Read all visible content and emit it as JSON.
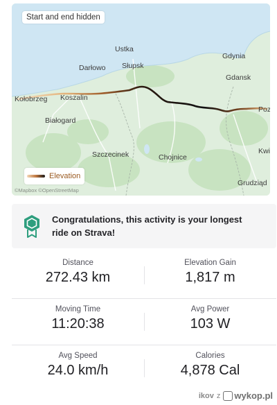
{
  "map": {
    "badge": "Start and end hidden",
    "legend_label": "Elevation",
    "attribution": "©Mapbox ©OpenStreetMap",
    "places": [
      "Ustka",
      "Gdynia",
      "Darłowo",
      "Słupsk",
      "Gdansk",
      "Kołobrzeg",
      "Koszalin",
      "Pozeu",
      "Białogard",
      "Szczecinek",
      "Chojnice",
      "Kwi",
      "Grudziąd"
    ],
    "colors": {
      "sea": "#cfe6f3",
      "land": "#dfeedd",
      "forest": "#c6e2c0",
      "route_low": "#f1d6b2",
      "route_high": "#1a1a1a"
    }
  },
  "notice": {
    "icon": "achievement-badge-icon",
    "text": "Congratulations, this activity is your longest ride on Strava!",
    "color": "#2e9e7e"
  },
  "stats": [
    {
      "label": "Distance",
      "value": "272.43 km"
    },
    {
      "label": "Elevation Gain",
      "value": "1,817 m"
    },
    {
      "label": "Moving Time",
      "value": "11:20:38"
    },
    {
      "label": "Avg Power",
      "value": "103 W"
    },
    {
      "label": "Avg Speed",
      "value": "24.0 km/h"
    },
    {
      "label": "Calories",
      "value": "4,878 Cal"
    }
  ],
  "footer": {
    "user": "ikov",
    "separator": "z",
    "site": "wykop.pl"
  }
}
